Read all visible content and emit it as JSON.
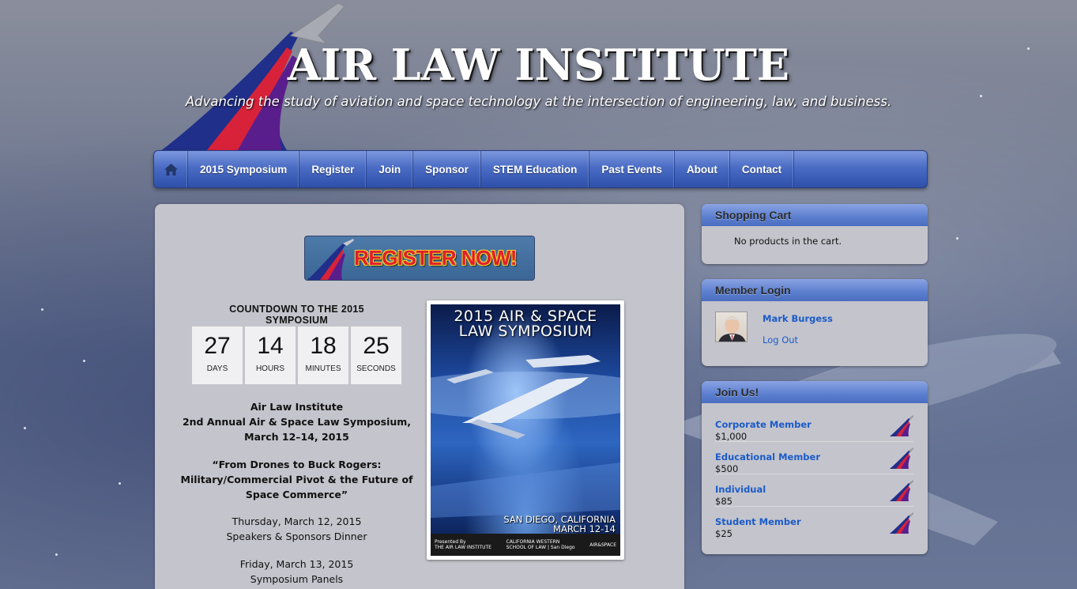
{
  "header": {
    "title": "AIR LAW INSTITUTE",
    "tagline": "Advancing the study of aviation and space technology at the intersection of engineering, law, and business."
  },
  "nav": {
    "home_icon": "home-icon",
    "items": [
      {
        "label": "2015 Symposium"
      },
      {
        "label": "Register"
      },
      {
        "label": "Join"
      },
      {
        "label": "Sponsor"
      },
      {
        "label": "STEM Education"
      },
      {
        "label": "Past Events"
      },
      {
        "label": "About"
      },
      {
        "label": "Contact"
      }
    ]
  },
  "main": {
    "register_banner": "REGISTER NOW!",
    "countdown_title": "COUNTDOWN TO THE 2015 SYMPOSIUM",
    "countdown": [
      {
        "value": "27",
        "label": "DAYS"
      },
      {
        "value": "14",
        "label": "HOURS"
      },
      {
        "value": "18",
        "label": "MINUTES"
      },
      {
        "value": "25",
        "label": "SECONDS"
      }
    ],
    "event": {
      "org": "Air Law Institute",
      "name": "2nd Annual Air & Space Law Symposium,",
      "dates": "March 12–14, 2015",
      "theme_1": "“From Drones to Buck Rogers:",
      "theme_2": "Military/Commercial Pivot & the Future of",
      "theme_3": "Space Commerce”",
      "day1_date": "Thursday, March 12, 2015",
      "day1_desc": "Speakers & Sponsors Dinner",
      "day2_date": "Friday, March 13, 2015",
      "day2_desc": "Symposium Panels"
    },
    "poster": {
      "title_1": "2015 AIR & SPACE",
      "title_2": "LAW SYMPOSIUM",
      "location_1": "SAN DIEGO, CALIFORNIA",
      "location_2": "MARCH 12-14",
      "presented_by": "Presented By",
      "presenter": "THE AIR LAW INSTITUTE",
      "partner_1a": "CALIFORNIA WESTERN",
      "partner_1b": "SCHOOL OF LAW | San Diego",
      "partner_2": "AIR&SPACE"
    }
  },
  "sidebar": {
    "cart": {
      "title": "Shopping Cart",
      "empty_text": "No products in the cart."
    },
    "login": {
      "title": "Member Login",
      "user_name": "Mark Burgess",
      "logout_label": "Log Out"
    },
    "join": {
      "title": "Join Us!",
      "items": [
        {
          "name": "Corporate Member",
          "price": "$1,000"
        },
        {
          "name": "Educational Member",
          "price": "$500"
        },
        {
          "name": "Individual",
          "price": "$85"
        },
        {
          "name": "Student Member",
          "price": "$25"
        }
      ]
    }
  },
  "colors": {
    "nav_blue": "#4a6cc4",
    "link_blue": "#1a5bc9",
    "panel_gray": "#c4c4cc",
    "brand_red": "#d8223a",
    "brand_purple": "#5a1e8c",
    "brand_navy": "#1f2f8a"
  }
}
